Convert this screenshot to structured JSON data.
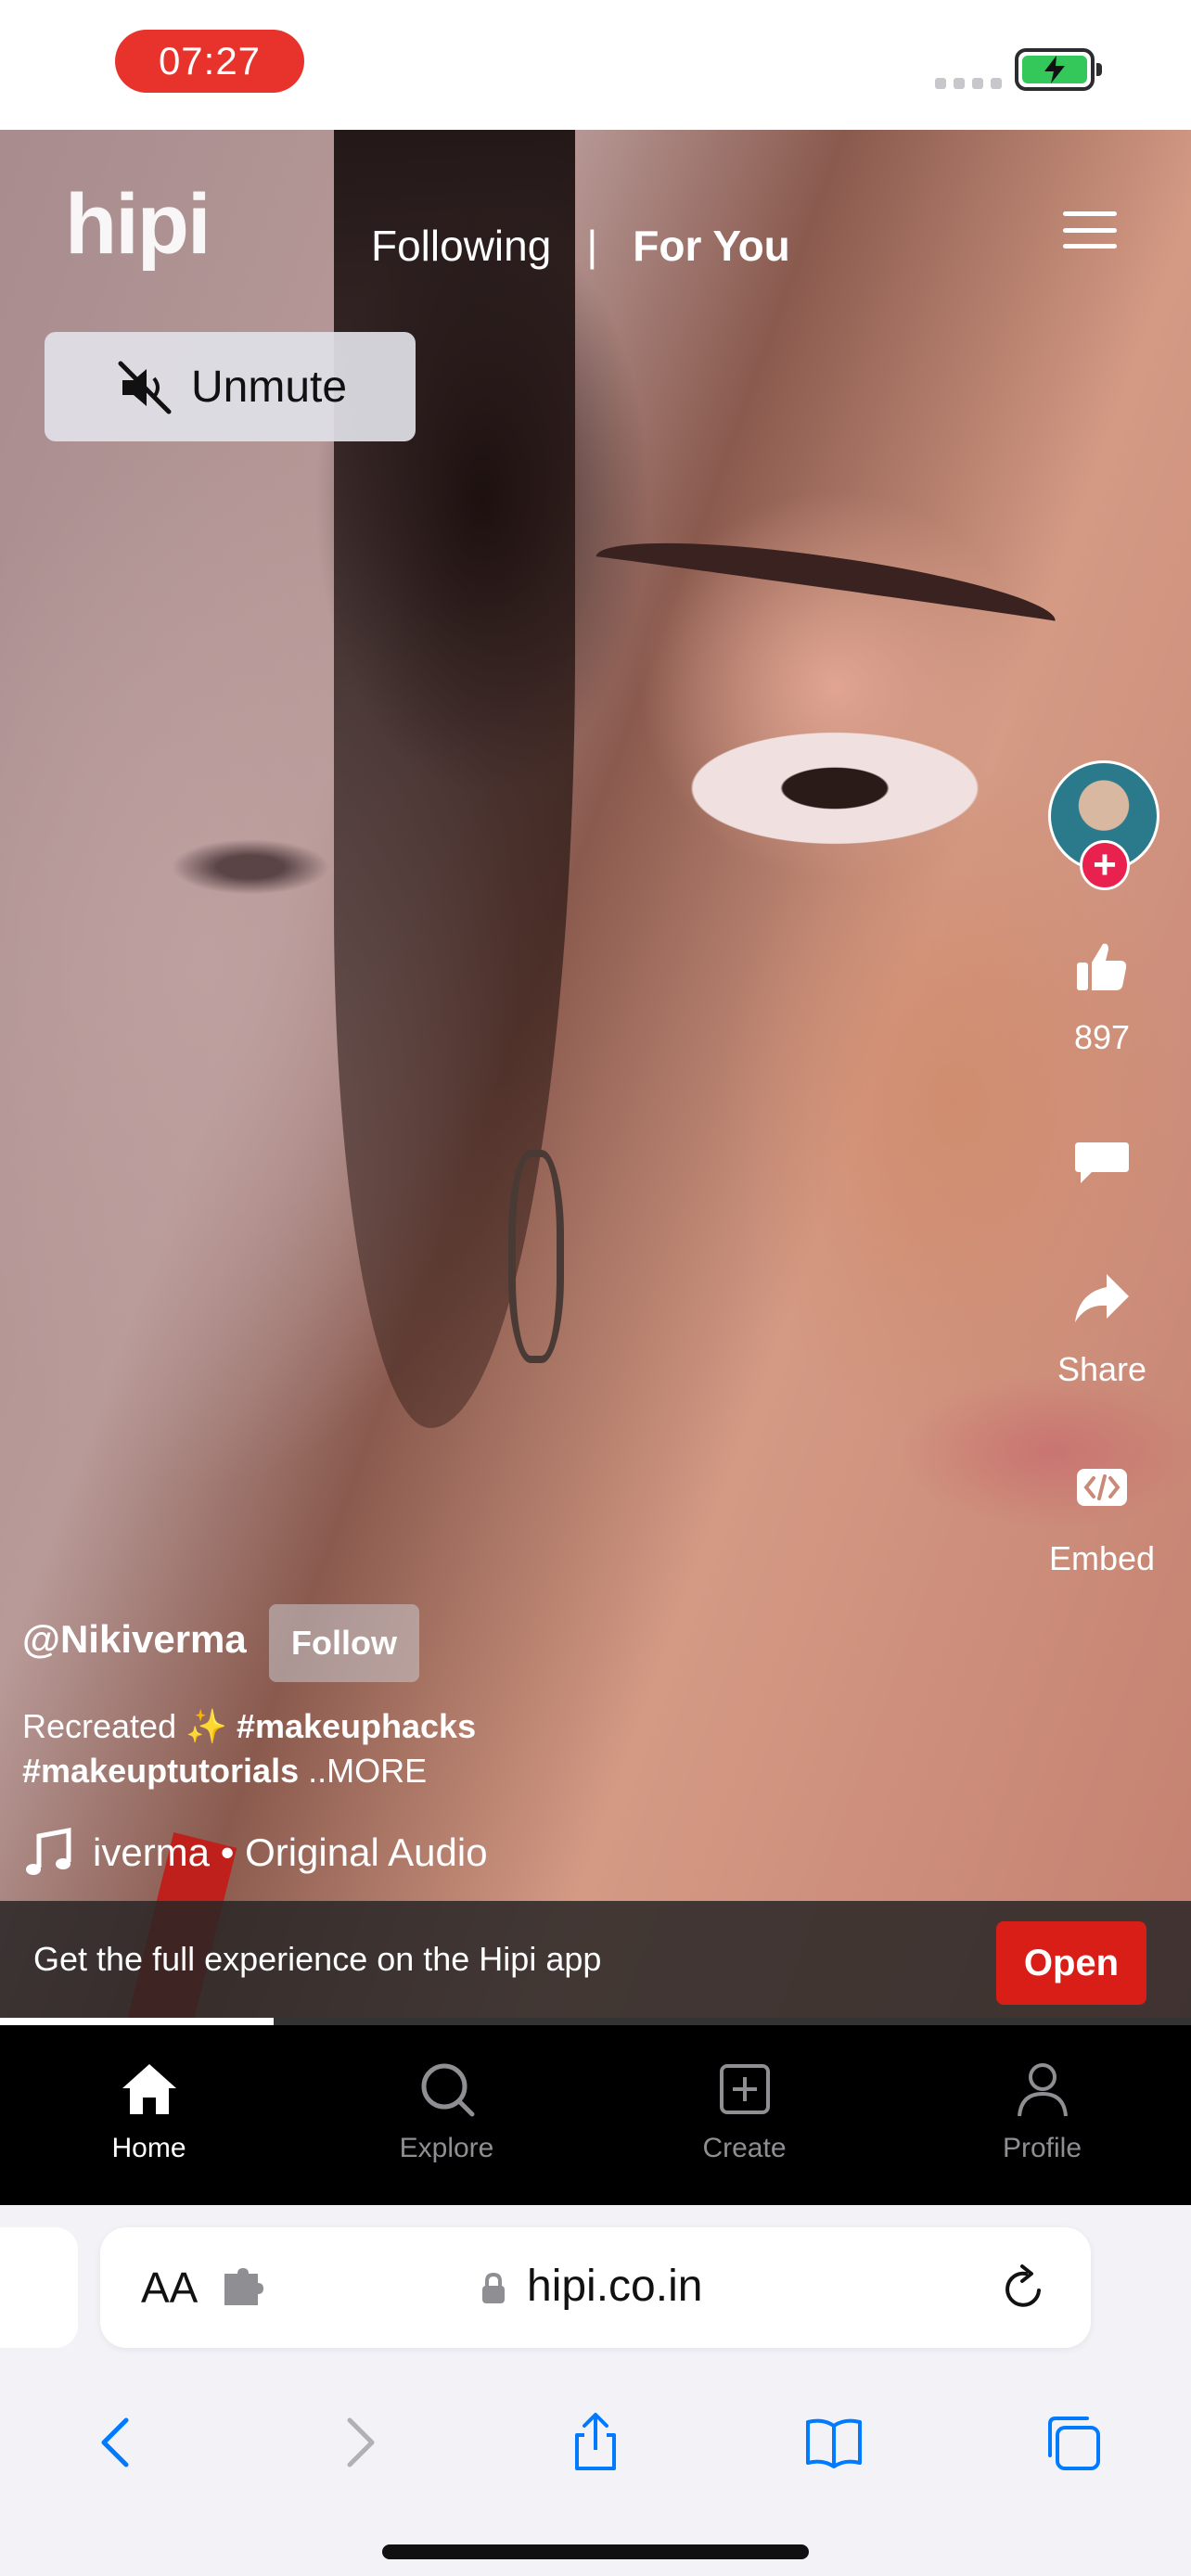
{
  "status_bar": {
    "time": "07:27"
  },
  "header": {
    "logo": "hipi",
    "tabs": [
      {
        "label": "Following",
        "active": false
      },
      {
        "label": "For You",
        "active": true
      }
    ],
    "separator": "|",
    "menu_icon": "hamburger-icon"
  },
  "unmute_button": {
    "label": "Unmute",
    "icon": "muted-speaker-icon"
  },
  "actions": {
    "avatar_plus": "+",
    "like_count": "897",
    "like_icon": "thumbs-up-icon",
    "comment_icon": "comment-icon",
    "share_label": "Share",
    "share_icon": "share-arrow-icon",
    "embed_label": "Embed",
    "embed_icon": "embed-code-icon"
  },
  "post": {
    "username": "@Nikiverma",
    "follow_label": "Follow",
    "caption_text": "Recreated ✨ ",
    "hashtag_1": "#makeuphacks",
    "hashtag_2": "#makeuptutorials",
    "more_label": " ..MORE",
    "audio": "iverma • Original Audio"
  },
  "app_banner": {
    "text": "Get the full experience on the Hipi app",
    "open_label": "Open"
  },
  "video_progress": 0.23,
  "bottom_nav": [
    {
      "label": "Home",
      "icon": "home-icon",
      "active": true
    },
    {
      "label": "Explore",
      "icon": "search-icon",
      "active": false
    },
    {
      "label": "Create",
      "icon": "plus-square-icon",
      "active": false
    },
    {
      "label": "Profile",
      "icon": "person-icon",
      "active": false
    }
  ],
  "browser": {
    "text_size_label": "AA",
    "url": "hipi.co.in",
    "toolbar_icons": [
      "back-icon",
      "forward-icon",
      "share-icon",
      "bookmarks-icon",
      "tabs-icon"
    ]
  },
  "colors": {
    "accent_red": "#d81e17",
    "time_pill": "#e8332c",
    "battery": "#34c759",
    "plus_badge": "#e8214f",
    "safari_blue": "#007aff"
  }
}
